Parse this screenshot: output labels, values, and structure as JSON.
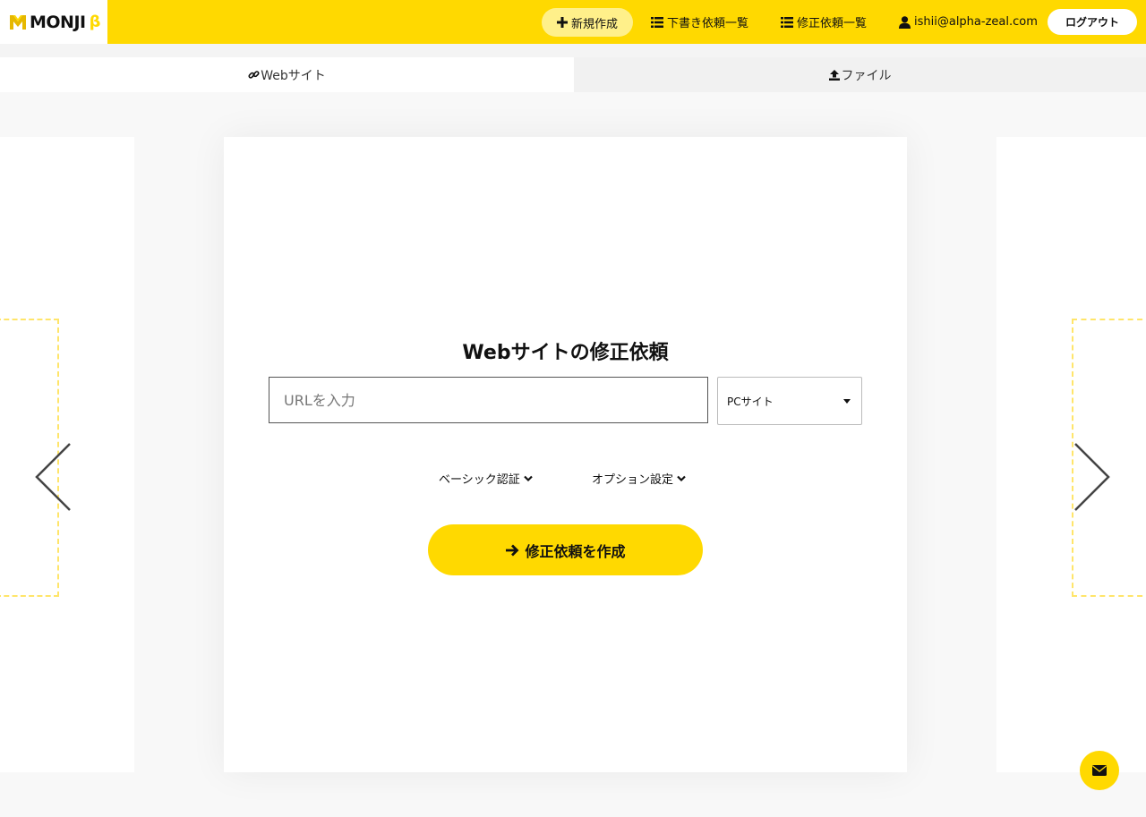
{
  "brand": {
    "name": "MONJI",
    "beta": "β",
    "accent": "#ffd900"
  },
  "header": {
    "new_label": "新規作成",
    "drafts_label": "下書き依頼一覧",
    "revisions_label": "修正依頼一覧",
    "user_email": "ishii@alpha-zeal.com",
    "logout_label": "ログアウト"
  },
  "tabs": [
    {
      "label": "Webサイト",
      "icon": "link-icon",
      "active": true
    },
    {
      "label": "ファイル",
      "icon": "upload-icon",
      "active": false
    }
  ],
  "form": {
    "title": "Webサイトの修正依頼",
    "url_placeholder": "URLを入力",
    "url_value": "",
    "site_type_selected": "PCサイト",
    "basic_auth_label": "ベーシック認証",
    "options_label": "オプション設定",
    "submit_label": "修正依頼を作成"
  },
  "icons": {
    "new": "plus-icon",
    "list": "list-icon",
    "user": "user-icon",
    "prev": "chevron-left-icon",
    "next": "chevron-right-icon",
    "mail": "envelope-icon"
  }
}
